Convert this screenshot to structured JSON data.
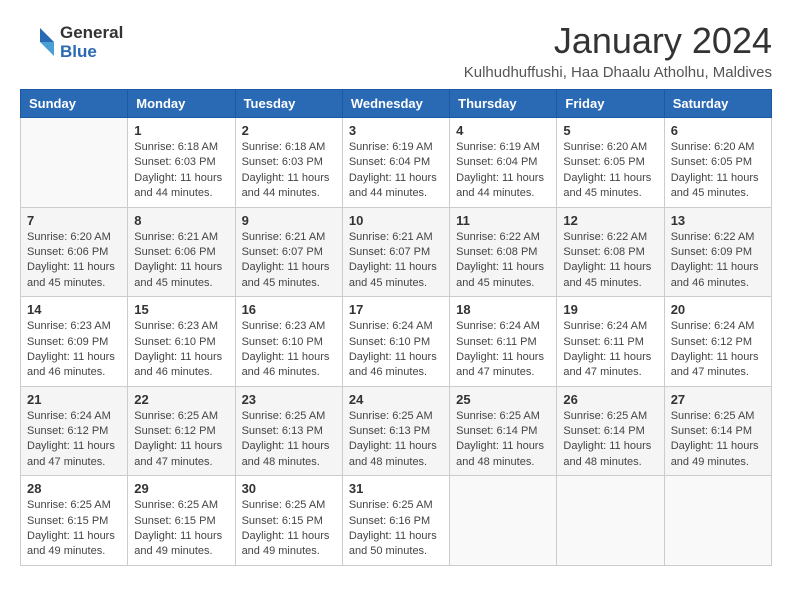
{
  "header": {
    "logo_general": "General",
    "logo_blue": "Blue",
    "month_title": "January 2024",
    "location": "Kulhudhuffushi, Haa Dhaalu Atholhu, Maldives"
  },
  "weekdays": [
    "Sunday",
    "Monday",
    "Tuesday",
    "Wednesday",
    "Thursday",
    "Friday",
    "Saturday"
  ],
  "weeks": [
    [
      {
        "day": "",
        "info": ""
      },
      {
        "day": "1",
        "info": "Sunrise: 6:18 AM\nSunset: 6:03 PM\nDaylight: 11 hours\nand 44 minutes."
      },
      {
        "day": "2",
        "info": "Sunrise: 6:18 AM\nSunset: 6:03 PM\nDaylight: 11 hours\nand 44 minutes."
      },
      {
        "day": "3",
        "info": "Sunrise: 6:19 AM\nSunset: 6:04 PM\nDaylight: 11 hours\nand 44 minutes."
      },
      {
        "day": "4",
        "info": "Sunrise: 6:19 AM\nSunset: 6:04 PM\nDaylight: 11 hours\nand 44 minutes."
      },
      {
        "day": "5",
        "info": "Sunrise: 6:20 AM\nSunset: 6:05 PM\nDaylight: 11 hours\nand 45 minutes."
      },
      {
        "day": "6",
        "info": "Sunrise: 6:20 AM\nSunset: 6:05 PM\nDaylight: 11 hours\nand 45 minutes."
      }
    ],
    [
      {
        "day": "7",
        "info": "Sunrise: 6:20 AM\nSunset: 6:06 PM\nDaylight: 11 hours\nand 45 minutes."
      },
      {
        "day": "8",
        "info": "Sunrise: 6:21 AM\nSunset: 6:06 PM\nDaylight: 11 hours\nand 45 minutes."
      },
      {
        "day": "9",
        "info": "Sunrise: 6:21 AM\nSunset: 6:07 PM\nDaylight: 11 hours\nand 45 minutes."
      },
      {
        "day": "10",
        "info": "Sunrise: 6:21 AM\nSunset: 6:07 PM\nDaylight: 11 hours\nand 45 minutes."
      },
      {
        "day": "11",
        "info": "Sunrise: 6:22 AM\nSunset: 6:08 PM\nDaylight: 11 hours\nand 45 minutes."
      },
      {
        "day": "12",
        "info": "Sunrise: 6:22 AM\nSunset: 6:08 PM\nDaylight: 11 hours\nand 45 minutes."
      },
      {
        "day": "13",
        "info": "Sunrise: 6:22 AM\nSunset: 6:09 PM\nDaylight: 11 hours\nand 46 minutes."
      }
    ],
    [
      {
        "day": "14",
        "info": "Sunrise: 6:23 AM\nSunset: 6:09 PM\nDaylight: 11 hours\nand 46 minutes."
      },
      {
        "day": "15",
        "info": "Sunrise: 6:23 AM\nSunset: 6:10 PM\nDaylight: 11 hours\nand 46 minutes."
      },
      {
        "day": "16",
        "info": "Sunrise: 6:23 AM\nSunset: 6:10 PM\nDaylight: 11 hours\nand 46 minutes."
      },
      {
        "day": "17",
        "info": "Sunrise: 6:24 AM\nSunset: 6:10 PM\nDaylight: 11 hours\nand 46 minutes."
      },
      {
        "day": "18",
        "info": "Sunrise: 6:24 AM\nSunset: 6:11 PM\nDaylight: 11 hours\nand 47 minutes."
      },
      {
        "day": "19",
        "info": "Sunrise: 6:24 AM\nSunset: 6:11 PM\nDaylight: 11 hours\nand 47 minutes."
      },
      {
        "day": "20",
        "info": "Sunrise: 6:24 AM\nSunset: 6:12 PM\nDaylight: 11 hours\nand 47 minutes."
      }
    ],
    [
      {
        "day": "21",
        "info": "Sunrise: 6:24 AM\nSunset: 6:12 PM\nDaylight: 11 hours\nand 47 minutes."
      },
      {
        "day": "22",
        "info": "Sunrise: 6:25 AM\nSunset: 6:12 PM\nDaylight: 11 hours\nand 47 minutes."
      },
      {
        "day": "23",
        "info": "Sunrise: 6:25 AM\nSunset: 6:13 PM\nDaylight: 11 hours\nand 48 minutes."
      },
      {
        "day": "24",
        "info": "Sunrise: 6:25 AM\nSunset: 6:13 PM\nDaylight: 11 hours\nand 48 minutes."
      },
      {
        "day": "25",
        "info": "Sunrise: 6:25 AM\nSunset: 6:14 PM\nDaylight: 11 hours\nand 48 minutes."
      },
      {
        "day": "26",
        "info": "Sunrise: 6:25 AM\nSunset: 6:14 PM\nDaylight: 11 hours\nand 48 minutes."
      },
      {
        "day": "27",
        "info": "Sunrise: 6:25 AM\nSunset: 6:14 PM\nDaylight: 11 hours\nand 49 minutes."
      }
    ],
    [
      {
        "day": "28",
        "info": "Sunrise: 6:25 AM\nSunset: 6:15 PM\nDaylight: 11 hours\nand 49 minutes."
      },
      {
        "day": "29",
        "info": "Sunrise: 6:25 AM\nSunset: 6:15 PM\nDaylight: 11 hours\nand 49 minutes."
      },
      {
        "day": "30",
        "info": "Sunrise: 6:25 AM\nSunset: 6:15 PM\nDaylight: 11 hours\nand 49 minutes."
      },
      {
        "day": "31",
        "info": "Sunrise: 6:25 AM\nSunset: 6:16 PM\nDaylight: 11 hours\nand 50 minutes."
      },
      {
        "day": "",
        "info": ""
      },
      {
        "day": "",
        "info": ""
      },
      {
        "day": "",
        "info": ""
      }
    ]
  ]
}
